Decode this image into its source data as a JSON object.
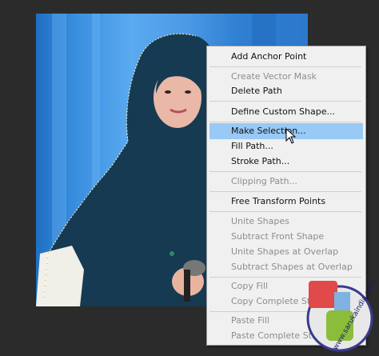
{
  "menu": {
    "items": [
      {
        "label": "Add Anchor Point",
        "enabled": true
      },
      {
        "label": "Create Vector Mask",
        "enabled": false
      },
      {
        "label": "Delete Path",
        "enabled": true
      },
      {
        "label": "Define Custom Shape...",
        "enabled": true
      },
      {
        "label": "Make Selection...",
        "enabled": true,
        "highlighted": true
      },
      {
        "label": "Fill Path...",
        "enabled": true
      },
      {
        "label": "Stroke Path...",
        "enabled": true
      },
      {
        "label": "Clipping Path...",
        "enabled": false
      },
      {
        "label": "Free Transform Points",
        "enabled": true
      },
      {
        "label": "Unite Shapes",
        "enabled": false
      },
      {
        "label": "Subtract Front Shape",
        "enabled": false
      },
      {
        "label": "Unite Shapes at Overlap",
        "enabled": false
      },
      {
        "label": "Subtract Shapes at Overlap",
        "enabled": false
      },
      {
        "label": "Copy Fill",
        "enabled": false
      },
      {
        "label": "Copy Complete Stroke",
        "enabled": false
      },
      {
        "label": "Paste Fill",
        "enabled": false
      },
      {
        "label": "Paste Complete Stroke",
        "enabled": false
      }
    ]
  },
  "colors": {
    "menu_bg": "#f0f0f0",
    "highlight": "#99c9f5",
    "disabled_text": "#8d8d8d",
    "canvas_bg": "#2b2b2b"
  },
  "icons": {
    "cursor": "arrow-pointer-icon",
    "watermark": "watermark-logo-icon"
  },
  "watermark": {
    "text": "www.sarukaindia.com"
  }
}
